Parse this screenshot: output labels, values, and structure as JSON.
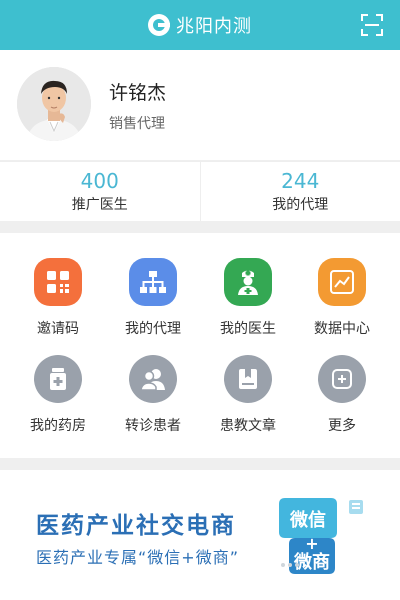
{
  "header": {
    "title": "兆阳内测",
    "logo_icon": "brand-logo-icon",
    "scan_icon": "scan-icon"
  },
  "profile": {
    "name": "许铭杰",
    "role": "销售代理"
  },
  "stats": [
    {
      "value": "400",
      "label": "推广医生"
    },
    {
      "value": "244",
      "label": "我的代理"
    }
  ],
  "menu": [
    {
      "label": "邀请码",
      "icon": "qr-code-icon",
      "color": "#f4703c"
    },
    {
      "label": "我的代理",
      "icon": "org-chart-icon",
      "color": "#5b8de8"
    },
    {
      "label": "我的医生",
      "icon": "doctor-icon",
      "color": "#34a853"
    },
    {
      "label": "数据中心",
      "icon": "chart-icon",
      "color": "#f39a32"
    },
    {
      "label": "我的药房",
      "icon": "pharmacy-icon",
      "color": "#9aa1ab"
    },
    {
      "label": "转诊患者",
      "icon": "patients-icon",
      "color": "#9aa1ab"
    },
    {
      "label": "患教文章",
      "icon": "article-icon",
      "color": "#9aa1ab"
    },
    {
      "label": "更多",
      "icon": "more-plus-icon",
      "color": "#9aa1ab"
    }
  ],
  "banner": {
    "title": "医药产业社交电商",
    "subtitle": "医药产业专属“微信+微商”",
    "art_top": "微信",
    "art_plus": "+",
    "art_bottom": "微商"
  },
  "colors": {
    "header_bg": "#3ebfcf",
    "accent": "#4ab7d3",
    "banner_text": "#2b6fb5"
  }
}
